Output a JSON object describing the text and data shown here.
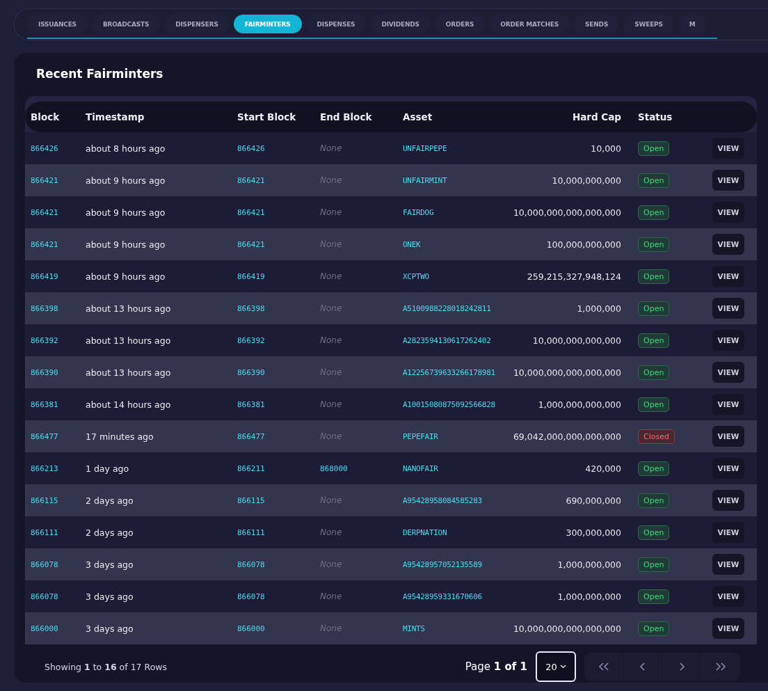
{
  "tabs": [
    {
      "label": "ISSUANCES",
      "selected": false
    },
    {
      "label": "BROADCASTS",
      "selected": false
    },
    {
      "label": "DISPENSERS",
      "selected": false
    },
    {
      "label": "FAIRMINTERS",
      "selected": true
    },
    {
      "label": "DISPENSES",
      "selected": false
    },
    {
      "label": "DIVIDENDS",
      "selected": false
    },
    {
      "label": "ORDERS",
      "selected": false
    },
    {
      "label": "ORDER MATCHES",
      "selected": false
    },
    {
      "label": "SENDS",
      "selected": false
    },
    {
      "label": "SWEEPS",
      "selected": false
    },
    {
      "label": "M",
      "selected": false
    }
  ],
  "card": {
    "title": "Recent Fairminters"
  },
  "table": {
    "columns": [
      "Block",
      "Timestamp",
      "Start Block",
      "End Block",
      "Asset",
      "Hard Cap",
      "Status"
    ],
    "rows": [
      {
        "block": "866426",
        "timestamp": "about 8 hours ago",
        "start_block": "866426",
        "end_block": {
          "text": "None",
          "kind": "empty"
        },
        "asset": "UNFAIRPEPE",
        "hard_cap": "10,000",
        "status": {
          "text": "Open",
          "kind": "open"
        },
        "action": "VIEW"
      },
      {
        "block": "866421",
        "timestamp": "about 9 hours ago",
        "start_block": "866421",
        "end_block": {
          "text": "None",
          "kind": "empty"
        },
        "asset": "UNFAIRMINT",
        "hard_cap": "10,000,000,000",
        "status": {
          "text": "Open",
          "kind": "open"
        },
        "action": "VIEW"
      },
      {
        "block": "866421",
        "timestamp": "about 9 hours ago",
        "start_block": "866421",
        "end_block": {
          "text": "None",
          "kind": "empty"
        },
        "asset": "FAIRDOG",
        "hard_cap": "10,000,000,000,000,000",
        "status": {
          "text": "Open",
          "kind": "open"
        },
        "action": "VIEW"
      },
      {
        "block": "866421",
        "timestamp": "about 9 hours ago",
        "start_block": "866421",
        "end_block": {
          "text": "None",
          "kind": "empty"
        },
        "asset": "ONEK",
        "hard_cap": "100,000,000,000",
        "status": {
          "text": "Open",
          "kind": "open"
        },
        "action": "VIEW"
      },
      {
        "block": "866419",
        "timestamp": "about 9 hours ago",
        "start_block": "866419",
        "end_block": {
          "text": "None",
          "kind": "empty"
        },
        "asset": "XCPTWO",
        "hard_cap": "259,215,327,948,124",
        "status": {
          "text": "Open",
          "kind": "open"
        },
        "action": "VIEW"
      },
      {
        "block": "866398",
        "timestamp": "about 13 hours ago",
        "start_block": "866398",
        "end_block": {
          "text": "None",
          "kind": "empty"
        },
        "asset": "A5100988228018242811",
        "hard_cap": "1,000,000",
        "status": {
          "text": "Open",
          "kind": "open"
        },
        "action": "VIEW"
      },
      {
        "block": "866392",
        "timestamp": "about 13 hours ago",
        "start_block": "866392",
        "end_block": {
          "text": "None",
          "kind": "empty"
        },
        "asset": "A2823594130617262402",
        "hard_cap": "10,000,000,000,000",
        "status": {
          "text": "Open",
          "kind": "open"
        },
        "action": "VIEW"
      },
      {
        "block": "866390",
        "timestamp": "about 13 hours ago",
        "start_block": "866390",
        "end_block": {
          "text": "None",
          "kind": "empty"
        },
        "asset": "A12256739633266178981",
        "hard_cap": "10,000,000,000,000,000",
        "status": {
          "text": "Open",
          "kind": "open"
        },
        "action": "VIEW"
      },
      {
        "block": "866381",
        "timestamp": "about 14 hours ago",
        "start_block": "866381",
        "end_block": {
          "text": "None",
          "kind": "empty"
        },
        "asset": "A10015080875092566828",
        "hard_cap": "1,000,000,000,000",
        "status": {
          "text": "Open",
          "kind": "open"
        },
        "action": "VIEW"
      },
      {
        "block": "866477",
        "timestamp": "17 minutes ago",
        "start_block": "866477",
        "end_block": {
          "text": "None",
          "kind": "empty"
        },
        "asset": "PEPEFAIR",
        "hard_cap": "69,042,000,000,000,000",
        "status": {
          "text": "Closed",
          "kind": "closed"
        },
        "action": "VIEW"
      },
      {
        "block": "866213",
        "timestamp": "1 day ago",
        "start_block": "866211",
        "end_block": {
          "text": "868000",
          "kind": "link"
        },
        "asset": "NANOFAIR",
        "hard_cap": "420,000",
        "status": {
          "text": "Open",
          "kind": "open"
        },
        "action": "VIEW"
      },
      {
        "block": "866115",
        "timestamp": "2 days ago",
        "start_block": "866115",
        "end_block": {
          "text": "None",
          "kind": "empty"
        },
        "asset": "A95428958084585283",
        "hard_cap": "690,000,000",
        "status": {
          "text": "Open",
          "kind": "open"
        },
        "action": "VIEW"
      },
      {
        "block": "866111",
        "timestamp": "2 days ago",
        "start_block": "866111",
        "end_block": {
          "text": "None",
          "kind": "empty"
        },
        "asset": "DERPNATION",
        "hard_cap": "300,000,000",
        "status": {
          "text": "Open",
          "kind": "open"
        },
        "action": "VIEW"
      },
      {
        "block": "866078",
        "timestamp": "3 days ago",
        "start_block": "866078",
        "end_block": {
          "text": "None",
          "kind": "empty"
        },
        "asset": "A95428957052135589",
        "hard_cap": "1,000,000,000",
        "status": {
          "text": "Open",
          "kind": "open"
        },
        "action": "VIEW"
      },
      {
        "block": "866078",
        "timestamp": "3 days ago",
        "start_block": "866078",
        "end_block": {
          "text": "None",
          "kind": "empty"
        },
        "asset": "A95428959331670606",
        "hard_cap": "1,000,000,000",
        "status": {
          "text": "Open",
          "kind": "open"
        },
        "action": "VIEW"
      },
      {
        "block": "866000",
        "timestamp": "3 days ago",
        "start_block": "866000",
        "end_block": {
          "text": "None",
          "kind": "empty"
        },
        "asset": "MINTS",
        "hard_cap": "10,000,000,000,000,000",
        "status": {
          "text": "Open",
          "kind": "open"
        },
        "action": "VIEW"
      }
    ]
  },
  "footer": {
    "summary": "Showing **1** to **16** of 17 Rows",
    "page_label": "Page **1 of 1**",
    "page_size": "20"
  }
}
